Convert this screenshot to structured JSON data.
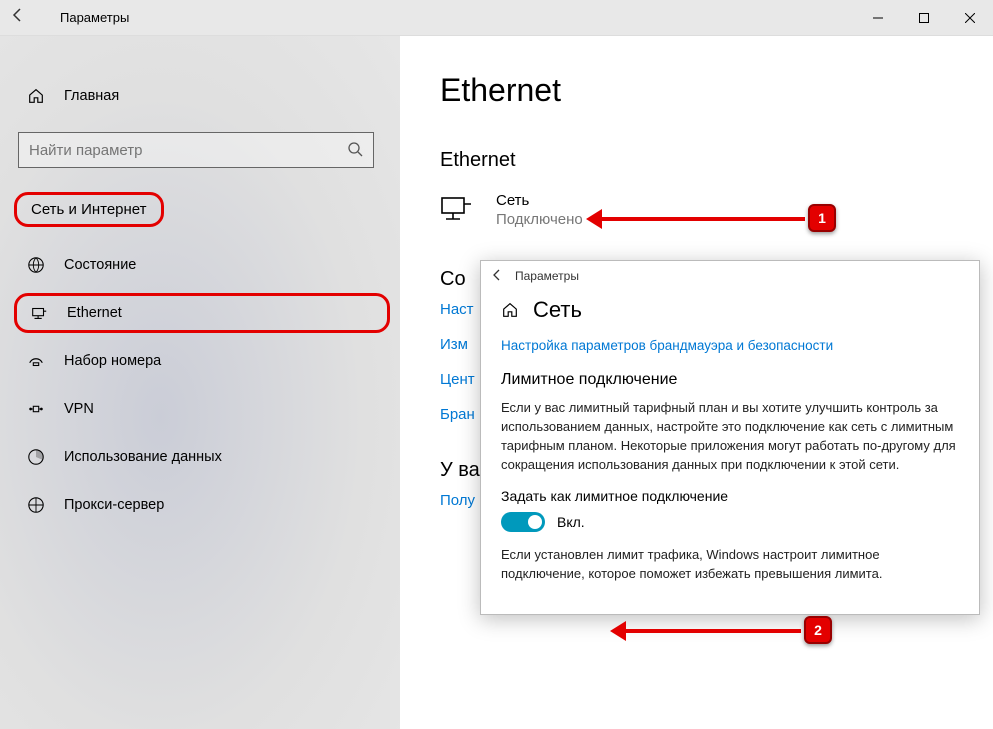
{
  "window": {
    "title": "Параметры"
  },
  "sidebar": {
    "home": "Главная",
    "search_placeholder": "Найти параметр",
    "section": "Сеть и Интернет",
    "items": [
      {
        "label": "Состояние"
      },
      {
        "label": "Ethernet"
      },
      {
        "label": "Набор номера"
      },
      {
        "label": "VPN"
      },
      {
        "label": "Использование данных"
      },
      {
        "label": "Прокси-сервер"
      }
    ]
  },
  "content": {
    "title": "Ethernet",
    "subtitle": "Ethernet",
    "network": {
      "name": "Сеть",
      "status": "Подключено"
    },
    "related_heading_truncated": "Со",
    "links": [
      "Наст",
      "Изм",
      "Цент",
      "Бран"
    ],
    "question_heading_truncated": "У ва",
    "question_link": "Полу"
  },
  "popup": {
    "titlebar": "Параметры",
    "heading": "Сеть",
    "firewall_link": "Настройка параметров брандмауэра и безопасности",
    "metered_heading": "Лимитное подключение",
    "metered_desc": "Если у вас лимитный тарифный план и вы хотите улучшить контроль за использованием данных, настройте это подключение как сеть с лимитным тарифным планом. Некоторые приложения могут работать по-другому для сокращения использования данных при подключении к этой сети.",
    "toggle_caption": "Задать как лимитное подключение",
    "toggle_state": "Вкл.",
    "limit_note": "Если установлен лимит трафика, Windows настроит лимитное подключение, которое поможет избежать превышения лимита."
  },
  "annotations": {
    "badge1": "1",
    "badge2": "2"
  }
}
